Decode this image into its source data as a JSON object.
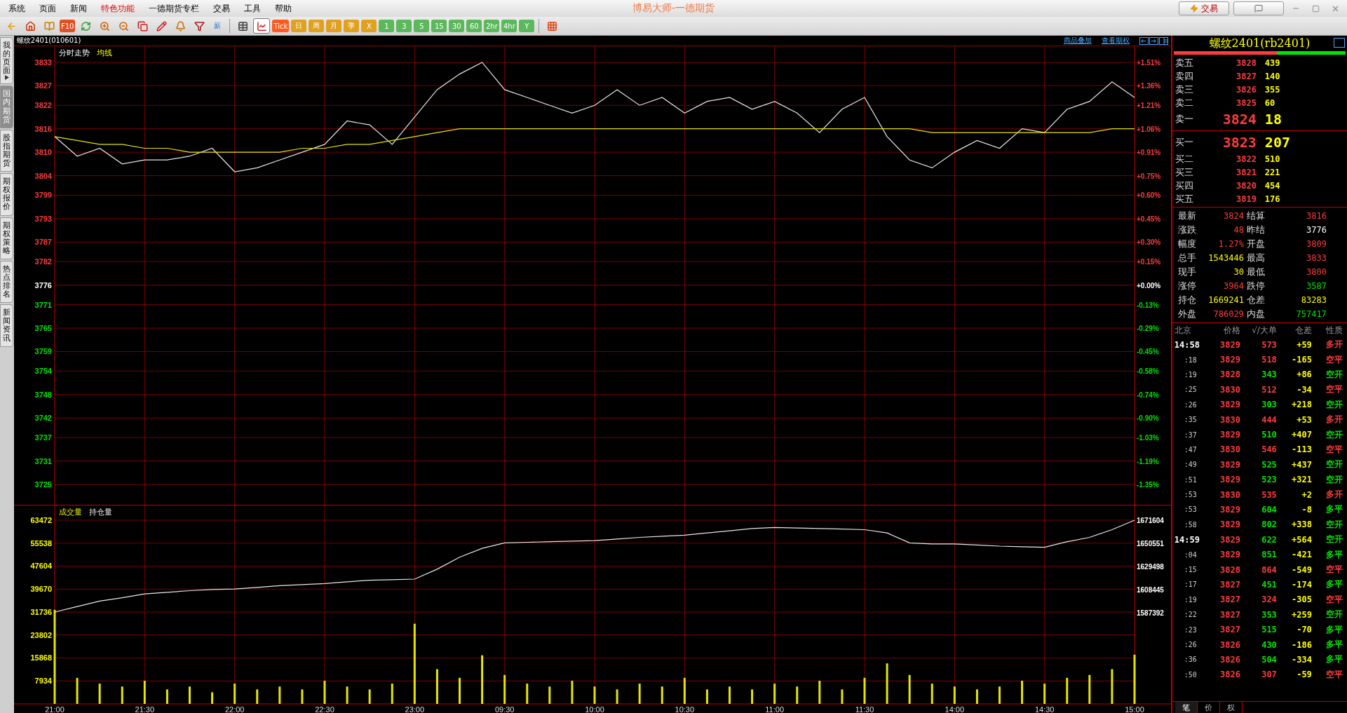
{
  "menu": [
    {
      "label": "系统",
      "selected": false
    },
    {
      "label": "页面",
      "selected": false
    },
    {
      "label": "新闻",
      "selected": false
    },
    {
      "label": "特色功能",
      "selected": true
    },
    {
      "label": "一德期货专栏",
      "selected": false
    },
    {
      "label": "交易",
      "selected": false
    },
    {
      "label": "工具",
      "selected": false
    },
    {
      "label": "帮助",
      "selected": false
    }
  ],
  "window_title": "博易大师-一德期货",
  "trade_button": "交易",
  "tools": [
    "F10",
    "新"
  ],
  "periods": [
    {
      "label": "Tick",
      "kind": "tick"
    },
    {
      "label": "日",
      "kind": "calendar"
    },
    {
      "label": "周",
      "kind": "calendar"
    },
    {
      "label": "月",
      "kind": "calendar"
    },
    {
      "label": "季",
      "kind": "calendar"
    },
    {
      "label": "X",
      "kind": "calendar"
    },
    {
      "label": "1",
      "kind": "minute"
    },
    {
      "label": "3",
      "kind": "minute"
    },
    {
      "label": "5",
      "kind": "minute"
    },
    {
      "label": "15",
      "kind": "minute"
    },
    {
      "label": "30",
      "kind": "minute"
    },
    {
      "label": "60",
      "kind": "minute"
    },
    {
      "label": "2hr",
      "kind": "minute"
    },
    {
      "label": "4hr",
      "kind": "minute"
    },
    {
      "label": "Y",
      "kind": "minute"
    }
  ],
  "side_tabs": [
    {
      "label": "我的页面",
      "selected": false
    },
    {
      "label": "国内期货",
      "selected": true
    },
    {
      "label": "股指期货",
      "selected": false
    },
    {
      "label": "期权报价",
      "selected": false
    },
    {
      "label": "期权策略",
      "selected": false
    },
    {
      "label": "热点排名",
      "selected": false
    },
    {
      "label": "新闻资讯",
      "selected": false
    }
  ],
  "chart_header": {
    "symbol": "螺纹2401(010601)",
    "links": [
      "商品叠加",
      "查看期权"
    ]
  },
  "price_pane": {
    "right_ticks": [
      {
        "label": "+1.51%",
        "kind": "up"
      },
      {
        "label": "+1.36%",
        "kind": "up"
      },
      {
        "label": "+1.21%",
        "kind": "up"
      },
      {
        "label": "+1.06%",
        "kind": "up"
      },
      {
        "label": "+0.91%",
        "kind": "up"
      },
      {
        "label": "+0.75%",
        "kind": "up"
      },
      {
        "label": "+0.60%",
        "kind": "up"
      },
      {
        "label": "+0.45%",
        "kind": "up"
      },
      {
        "label": "+0.30%",
        "kind": "up"
      },
      {
        "label": "+0.15%",
        "kind": "up"
      },
      {
        "label": "+0.00%",
        "kind": "flat"
      },
      {
        "label": "-0.13%",
        "kind": "down"
      },
      {
        "label": "-0.29%",
        "kind": "down"
      },
      {
        "label": "-0.45%",
        "kind": "down"
      },
      {
        "label": "-0.58%",
        "kind": "down"
      },
      {
        "label": "-0.74%",
        "kind": "down"
      },
      {
        "label": "-0.90%",
        "kind": "down"
      },
      {
        "label": "-1.03%",
        "kind": "down"
      },
      {
        "label": "-1.19%",
        "kind": "down"
      },
      {
        "label": "-1.35%",
        "kind": "down"
      }
    ],
    "chart_data": {
      "type": "line",
      "grid": true,
      "ylim": [
        3719.8,
        3837.1
      ],
      "yticks": [
        3833,
        3827,
        3822,
        3816,
        3810,
        3804,
        3799,
        3793,
        3787,
        3782,
        3776,
        3771,
        3765,
        3759,
        3754,
        3748,
        3742,
        3737,
        3731,
        3725
      ],
      "series": [
        {
          "name": "分时走势",
          "color": "#e8e8e8",
          "values": [
            3814,
            3809,
            3811,
            3807,
            3808,
            3808,
            3809,
            3811,
            3805,
            3806,
            3808,
            3810,
            3812,
            3818,
            3817,
            3812,
            3819,
            3826,
            3830,
            3833,
            3826,
            3824,
            3822,
            3820,
            3822,
            3826,
            3822,
            3824,
            3820,
            3823,
            3824,
            3821,
            3823,
            3820,
            3815,
            3821,
            3824,
            3814,
            3808,
            3806,
            3810,
            3813,
            3811,
            3816,
            3815,
            3821,
            3823,
            3828,
            3824
          ]
        },
        {
          "name": "均线",
          "color": "#e6e600",
          "values": [
            3814,
            3813,
            3812,
            3812,
            3811,
            3811,
            3810,
            3810,
            3810,
            3810,
            3810,
            3811,
            3811,
            3812,
            3812,
            3813,
            3814,
            3815,
            3816,
            3816,
            3816,
            3816,
            3816,
            3816,
            3816,
            3816,
            3816,
            3816,
            3816,
            3816,
            3816,
            3816,
            3816,
            3816,
            3816,
            3816,
            3816,
            3816,
            3816,
            3815,
            3815,
            3815,
            3815,
            3815,
            3815,
            3815,
            3815,
            3816,
            3816
          ]
        }
      ]
    }
  },
  "volume_pane": {
    "chart_data": {
      "type": "bar",
      "ylim": [
        0,
        68540
      ],
      "yticks": [
        63472,
        55538,
        47604,
        39670,
        31736,
        23802,
        15868,
        7934
      ],
      "grid": true,
      "categories": [
        "21:00",
        null,
        null,
        null,
        "21:30",
        null,
        null,
        null,
        "22:00",
        null,
        null,
        null,
        "22:30",
        null,
        null,
        null,
        "23:00",
        null,
        null,
        null,
        "09:30",
        null,
        null,
        null,
        "10:00",
        null,
        null,
        null,
        "10:30",
        null,
        null,
        null,
        "11:00",
        null,
        null,
        null,
        "11:30",
        null,
        null,
        null,
        "14:00",
        null,
        null,
        null,
        "14:30",
        null,
        null,
        null,
        "15:00"
      ],
      "series": [
        {
          "name": "成交量",
          "color": "#e6e600",
          "values": [
            32500,
            9000,
            7000,
            6000,
            8000,
            5000,
            6000,
            4000,
            7000,
            5000,
            6000,
            5000,
            8000,
            6000,
            5000,
            7000,
            27700,
            12000,
            9000,
            16800,
            10000,
            7000,
            6000,
            8000,
            6000,
            5000,
            7000,
            6000,
            9000,
            5000,
            6000,
            5000,
            7000,
            6000,
            8000,
            5000,
            9000,
            14000,
            10000,
            7000,
            6000,
            5000,
            6000,
            8000,
            7000,
            9000,
            10000,
            12000,
            17000
          ]
        }
      ]
    },
    "oi_overlay": {
      "chart_data": {
        "type": "line",
        "ylim": [
          1587392,
          1671604
        ],
        "yticks": [
          1671604,
          1650551,
          1629498,
          1608445,
          1587392
        ],
        "series": [
          {
            "name": "持仓量",
            "color": "#e8e8e8",
            "values": [
              1588000,
              1593000,
              1598000,
              1601000,
              1604500,
              1606000,
              1607500,
              1608500,
              1609000,
              1610500,
              1612000,
              1613000,
              1614000,
              1615500,
              1617000,
              1617500,
              1618000,
              1627000,
              1638000,
              1646000,
              1651000,
              1651500,
              1652000,
              1652500,
              1653000,
              1654500,
              1656000,
              1657000,
              1658000,
              1660000,
              1662000,
              1664000,
              1665000,
              1664500,
              1664000,
              1663500,
              1663000,
              1660000,
              1651000,
              1650000,
              1650000,
              1649000,
              1648000,
              1647500,
              1647000,
              1652000,
              1656000,
              1663000,
              1671604
            ]
          }
        ]
      }
    }
  },
  "quote": {
    "title": "螺纹2401(rb2401)",
    "ratio": {
      "level": 0.6
    },
    "asks": [
      {
        "label": "卖五",
        "price": "3828",
        "volume": "439",
        "best": false
      },
      {
        "label": "卖四",
        "price": "3827",
        "volume": "140",
        "best": false
      },
      {
        "label": "卖三",
        "price": "3826",
        "volume": "355",
        "best": false
      },
      {
        "label": "卖二",
        "price": "3825",
        "volume": "60",
        "best": false
      },
      {
        "label": "卖一",
        "price": "3824",
        "volume": "18",
        "best": true
      }
    ],
    "bids": [
      {
        "label": "买一",
        "price": "3823",
        "volume": "207",
        "best": true
      },
      {
        "label": "买二",
        "price": "3822",
        "volume": "510",
        "best": false
      },
      {
        "label": "买三",
        "price": "3821",
        "volume": "221",
        "best": false
      },
      {
        "label": "买四",
        "price": "3820",
        "volume": "454",
        "best": false
      },
      {
        "label": "买五",
        "price": "3819",
        "volume": "176",
        "best": false
      }
    ],
    "stats": [
      {
        "label": "最新",
        "value": "3824",
        "color": "#ff3c3c"
      },
      {
        "label": "结算",
        "value": "3816",
        "color": "#ff3c3c"
      },
      {
        "label": "涨跌",
        "value": "48",
        "color": "#ff3c3c"
      },
      {
        "label": "昨结",
        "value": "3776",
        "color": "#ffffff"
      },
      {
        "label": "幅度",
        "value": "1.27%",
        "color": "#ff3c3c"
      },
      {
        "label": "开盘",
        "value": "3809",
        "color": "#ff3c3c"
      },
      {
        "label": "总手",
        "value": "1543446",
        "color": "#ffff00"
      },
      {
        "label": "最高",
        "value": "3833",
        "color": "#ff3c3c"
      },
      {
        "label": "现手",
        "value": "30",
        "color": "#ffff00"
      },
      {
        "label": "最低",
        "value": "3800",
        "color": "#ff3c3c"
      },
      {
        "label": "涨停",
        "value": "3964",
        "color": "#ff3c3c"
      },
      {
        "label": "跌停",
        "value": "3587",
        "color": "#00e600"
      },
      {
        "label": "持仓",
        "value": "1669241",
        "color": "#ffff00"
      },
      {
        "label": "仓差",
        "value": "83283",
        "color": "#ffff00"
      },
      {
        "label": "外盘",
        "value": "786029",
        "color": "#ff3c3c"
      },
      {
        "label": "内盘",
        "value": "757417",
        "color": "#00e600"
      }
    ],
    "tick_columns": [
      "北京",
      "价格",
      "√/大单",
      "仓差",
      "性质"
    ],
    "ticks": [
      {
        "time": "14:58",
        "kind": "minute",
        "price": "3829",
        "volume": "573",
        "change": "+59",
        "nature": "多开",
        "up": true
      },
      {
        "time": ":18",
        "kind": "second",
        "price": "3829",
        "volume": "518",
        "change": "-165",
        "nature": "空平",
        "up": true
      },
      {
        "time": ":19",
        "kind": "second",
        "price": "3828",
        "volume": "343",
        "change": "+86",
        "nature": "空开",
        "up": false
      },
      {
        "time": ":25",
        "kind": "second",
        "price": "3830",
        "volume": "512",
        "change": "-34",
        "nature": "空平",
        "up": true
      },
      {
        "time": ":26",
        "kind": "second",
        "price": "3829",
        "volume": "303",
        "change": "+218",
        "nature": "空开",
        "up": false
      },
      {
        "time": ":35",
        "kind": "second",
        "price": "3830",
        "volume": "444",
        "change": "+53",
        "nature": "多开",
        "up": true
      },
      {
        "time": ":37",
        "kind": "second",
        "price": "3829",
        "volume": "510",
        "change": "+407",
        "nature": "空开",
        "up": false
      },
      {
        "time": ":47",
        "kind": "second",
        "price": "3830",
        "volume": "546",
        "change": "-113",
        "nature": "空平",
        "up": true
      },
      {
        "time": ":49",
        "kind": "second",
        "price": "3829",
        "volume": "525",
        "change": "+437",
        "nature": "空开",
        "up": false
      },
      {
        "time": ":51",
        "kind": "second",
        "price": "3829",
        "volume": "523",
        "change": "+321",
        "nature": "空开",
        "up": false
      },
      {
        "time": ":53",
        "kind": "second",
        "price": "3830",
        "volume": "535",
        "change": "+2",
        "nature": "多开",
        "up": true
      },
      {
        "time": ":53",
        "kind": "second",
        "price": "3829",
        "volume": "604",
        "change": "-8",
        "nature": "多平",
        "up": false
      },
      {
        "time": ":58",
        "kind": "second",
        "price": "3829",
        "volume": "802",
        "change": "+338",
        "nature": "空开",
        "up": false
      },
      {
        "time": "14:59",
        "kind": "minute",
        "price": "3829",
        "volume": "622",
        "change": "+564",
        "nature": "空开",
        "up": false
      },
      {
        "time": ":04",
        "kind": "second",
        "price": "3829",
        "volume": "851",
        "change": "-421",
        "nature": "多平",
        "up": false
      },
      {
        "time": ":15",
        "kind": "second",
        "price": "3828",
        "volume": "864",
        "change": "-549",
        "nature": "空平",
        "up": true
      },
      {
        "time": ":17",
        "kind": "second",
        "price": "3827",
        "volume": "451",
        "change": "-174",
        "nature": "多平",
        "up": false
      },
      {
        "time": ":19",
        "kind": "second",
        "price": "3827",
        "volume": "324",
        "change": "-305",
        "nature": "空平",
        "up": true
      },
      {
        "time": ":22",
        "kind": "second",
        "price": "3827",
        "volume": "353",
        "change": "+259",
        "nature": "空开",
        "up": false
      },
      {
        "time": ":23",
        "kind": "second",
        "price": "3827",
        "volume": "515",
        "change": "-70",
        "nature": "多平",
        "up": false
      },
      {
        "time": ":26",
        "kind": "second",
        "price": "3826",
        "volume": "430",
        "change": "-186",
        "nature": "多平",
        "up": false
      },
      {
        "time": ":36",
        "kind": "second",
        "price": "3826",
        "volume": "504",
        "change": "-334",
        "nature": "多平",
        "up": false
      },
      {
        "time": ":50",
        "kind": "second",
        "price": "3826",
        "volume": "307",
        "change": "-59",
        "nature": "空平",
        "up": true
      }
    ],
    "tabs": [
      {
        "label": "笔",
        "selected": true
      },
      {
        "label": "价",
        "selected": false
      },
      {
        "label": "权",
        "selected": false
      }
    ]
  }
}
